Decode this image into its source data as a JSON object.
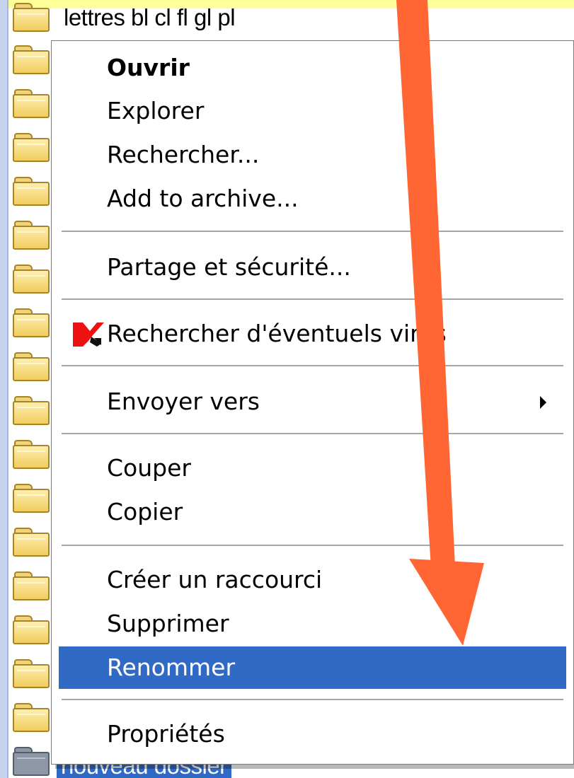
{
  "explorer": {
    "top_file_name": "lettres bl cl fl gl pl",
    "bottom_file_name": "nouveau dossier"
  },
  "context_menu": {
    "items": [
      {
        "label": "Ouvrir"
      },
      {
        "label": "Explorer"
      },
      {
        "label": "Rechercher..."
      },
      {
        "label": "Add to archive..."
      },
      {
        "label": "Partage et sécurité..."
      },
      {
        "label": "Rechercher d'éventuels virus"
      },
      {
        "label": "Envoyer vers"
      },
      {
        "label": "Couper"
      },
      {
        "label": "Copier"
      },
      {
        "label": "Créer un raccourci"
      },
      {
        "label": "Supprimer"
      },
      {
        "label": "Renommer"
      },
      {
        "label": "Propriétés"
      }
    ],
    "highlighted_item": "Renommer"
  },
  "annotation": {
    "arrow_color": "#ff6633"
  },
  "colors": {
    "selection_blue": "#316ac5",
    "highlight_yellow": "#ffff99"
  }
}
